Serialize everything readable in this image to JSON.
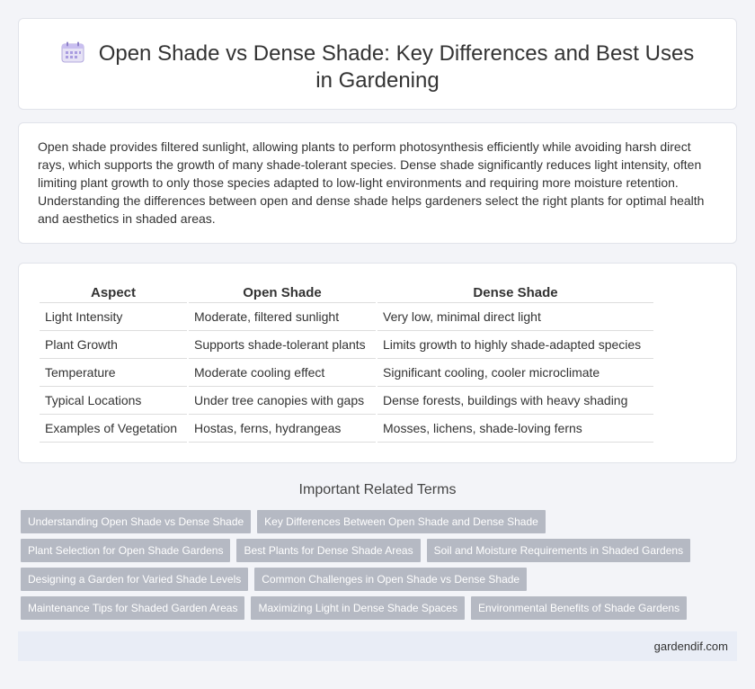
{
  "header": {
    "title": "Open Shade vs Dense Shade: Key Differences and Best Uses in Gardening",
    "icon": "calendar-icon"
  },
  "intro": {
    "text": "Open shade provides filtered sunlight, allowing plants to perform photosynthesis efficiently while avoiding harsh direct rays, which supports the growth of many shade-tolerant species. Dense shade significantly reduces light intensity, often limiting plant growth to only those species adapted to low-light environments and requiring more moisture retention. Understanding the differences between open and dense shade helps gardeners select the right plants for optimal health and aesthetics in shaded areas."
  },
  "table": {
    "headers": [
      "Aspect",
      "Open Shade",
      "Dense Shade"
    ],
    "rows": [
      [
        "Light Intensity",
        "Moderate, filtered sunlight",
        "Very low, minimal direct light"
      ],
      [
        "Plant Growth",
        "Supports shade-tolerant plants",
        "Limits growth to highly shade-adapted species"
      ],
      [
        "Temperature",
        "Moderate cooling effect",
        "Significant cooling, cooler microclimate"
      ],
      [
        "Typical Locations",
        "Under tree canopies with gaps",
        "Dense forests, buildings with heavy shading"
      ],
      [
        "Examples of Vegetation",
        "Hostas, ferns, hydrangeas",
        "Mosses, lichens, shade-loving ferns"
      ]
    ]
  },
  "related": {
    "title": "Important Related Terms",
    "tags": [
      "Understanding Open Shade vs Dense Shade",
      "Key Differences Between Open Shade and Dense Shade",
      "Plant Selection for Open Shade Gardens",
      "Best Plants for Dense Shade Areas",
      "Soil and Moisture Requirements in Shaded Gardens",
      "Designing a Garden for Varied Shade Levels",
      "Common Challenges in Open Shade vs Dense Shade",
      "Maintenance Tips for Shaded Garden Areas",
      "Maximizing Light in Dense Shade Spaces",
      "Environmental Benefits of Shade Gardens"
    ]
  },
  "footer": {
    "site": "gardendif.com"
  }
}
